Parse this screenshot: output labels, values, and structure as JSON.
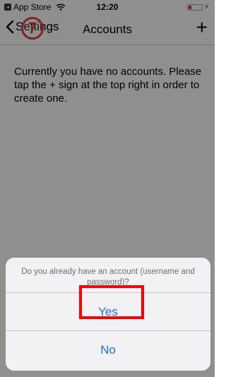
{
  "status_bar": {
    "back_app_label": "App Store",
    "time": "12:20",
    "battery_level": 0.2
  },
  "nav": {
    "back_label": "Settings",
    "title": "Accounts",
    "add_symbol": "+",
    "step_badge": "7"
  },
  "content": {
    "empty_message": "Currently you have no accounts. Please tap the + sign at the top right in order to create one."
  },
  "action_sheet": {
    "message": "Do you already have an account (username and password)?",
    "options": [
      "Yes",
      "No"
    ]
  },
  "colors": {
    "accent": "#1a73e8",
    "highlight": "#ff0000",
    "badge": "#e53935"
  },
  "icons": {
    "back": "chevron-left-icon",
    "wifi": "wifi-icon",
    "battery": "battery-icon"
  }
}
